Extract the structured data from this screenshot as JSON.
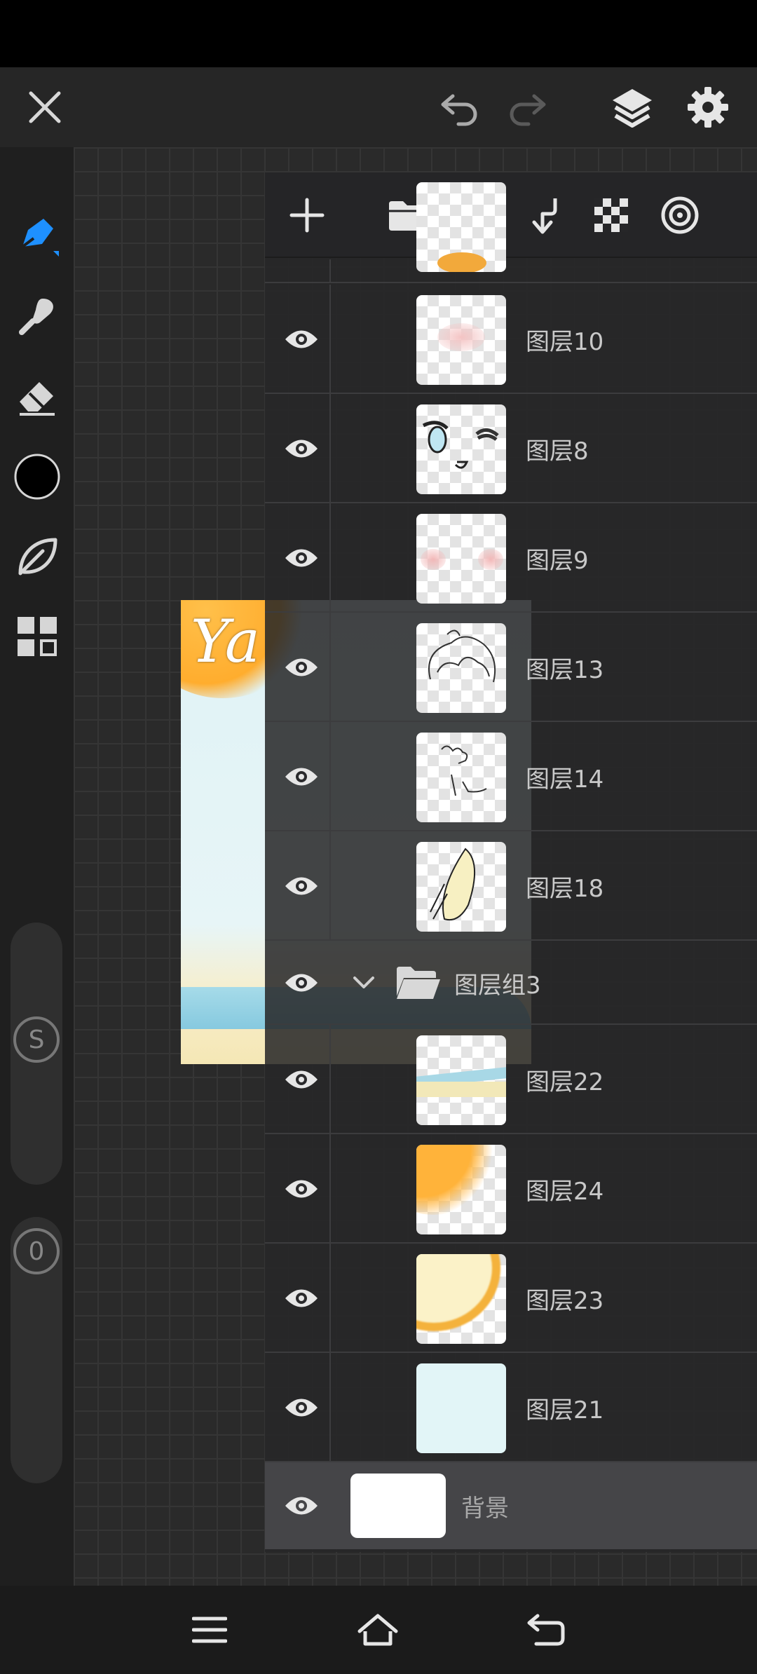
{
  "app": {
    "accent_color": "#1e90ff",
    "current_color": "#000000"
  },
  "top_bar": {
    "icons": [
      "close-icon",
      "undo-icon",
      "redo-icon",
      "layers-icon",
      "settings-icon"
    ]
  },
  "tool_rail": {
    "tools": [
      "brush-icon",
      "smudge-icon",
      "eraser-icon",
      "color-swatch",
      "leaf-icon",
      "gallery-icon"
    ],
    "size_slider_label": "S",
    "opacity_slider_label": "0"
  },
  "layer_panel": {
    "toolbar_icons": [
      "add-icon",
      "folder-icon",
      "lock-icon",
      "merge-down-icon",
      "transparency-icon",
      "target-icon"
    ],
    "layers": [
      {
        "name": "图层10"
      },
      {
        "name": "图层8"
      },
      {
        "name": "图层9"
      },
      {
        "name": "图层13"
      },
      {
        "name": "图层14"
      },
      {
        "name": "图层18"
      }
    ],
    "group": {
      "name": "图层组3"
    },
    "group_layers": [
      {
        "name": "图层22"
      },
      {
        "name": "图层24"
      },
      {
        "name": "图层23"
      },
      {
        "name": "图层21"
      }
    ],
    "background": {
      "name": "背景"
    }
  },
  "canvas": {
    "art_text": "Ya"
  },
  "nav_bar": {
    "icons": [
      "menu-icon",
      "home-icon",
      "back-icon"
    ]
  }
}
